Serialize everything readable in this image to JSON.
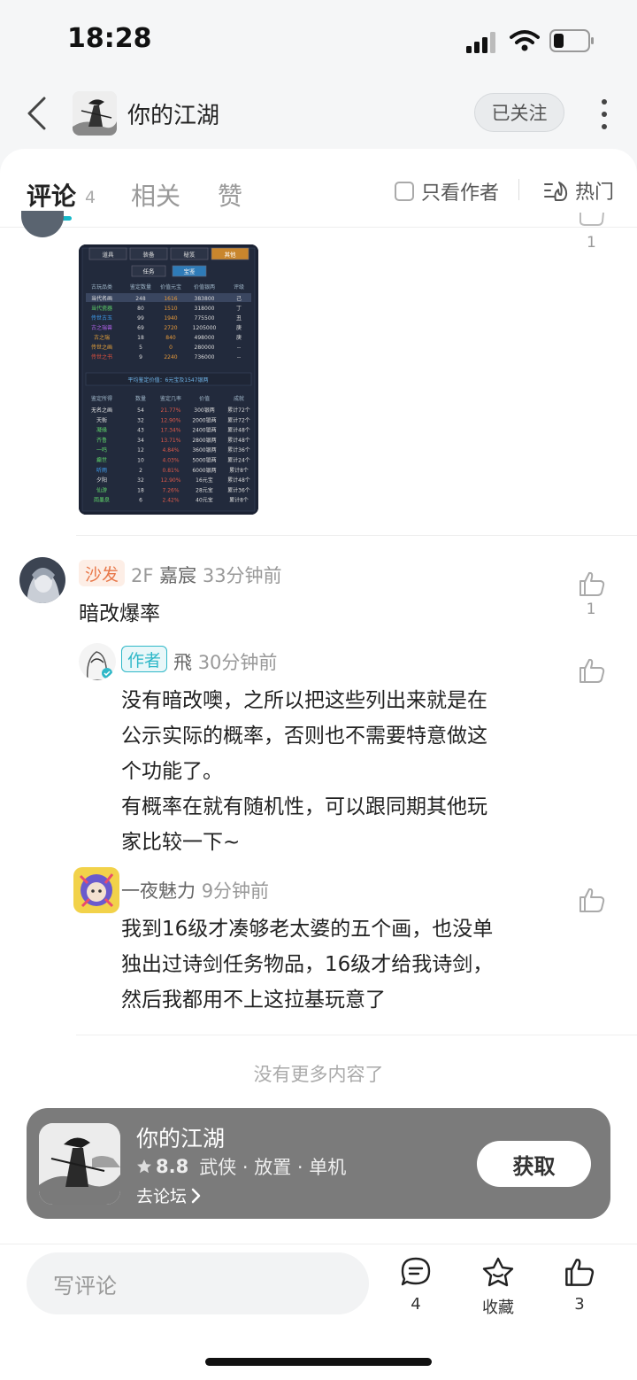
{
  "status": {
    "time": "18:28"
  },
  "header": {
    "title": "你的江湖",
    "follow_label": "已关注"
  },
  "tabs": {
    "comments": "评论",
    "comments_count": "4",
    "related": "相关",
    "likes": "赞",
    "author_only": "只看作者",
    "hot": "热门"
  },
  "partial_like_count": "1",
  "shot": {
    "tabs": [
      "道具",
      "装备",
      "秘笈",
      "其他"
    ],
    "subtabs": [
      "任务",
      "宝鉴"
    ],
    "head1": [
      "古玩品类",
      "鉴定数量",
      "价值元宝",
      "价值银两",
      "评级"
    ],
    "rows1": [
      [
        "当代名画",
        "248",
        "1616",
        "383800",
        "己"
      ],
      [
        "当代瓷器",
        "80",
        "1510",
        "318000",
        "丁"
      ],
      [
        "传世古玉",
        "99",
        "1940",
        "775500",
        "丑"
      ],
      [
        "古之瑞兽",
        "69",
        "2720",
        "1205000",
        "庚"
      ],
      [
        "古之瑞",
        "18",
        "840",
        "498000",
        "庚"
      ],
      [
        "传世之画",
        "5",
        "0",
        "280000",
        "--"
      ],
      [
        "传世之书",
        "9",
        "2240",
        "736000",
        "--"
      ]
    ],
    "avg": "平均鉴定价值：6元宝及1547银两",
    "head2": [
      "鉴定所得",
      "数量",
      "鉴定几率",
      "价值",
      "成就"
    ],
    "rows2": [
      [
        "无名之画",
        "54",
        "21.77%",
        "300银两",
        "累计72个"
      ],
      [
        "天街",
        "32",
        "12.90%",
        "2000银两",
        "累计72个"
      ],
      [
        "凝缘",
        "43",
        "17.34%",
        "2400银两",
        "累计48个"
      ],
      [
        "齐鲁",
        "34",
        "13.71%",
        "2800银两",
        "累计48个"
      ],
      [
        "一鸣",
        "12",
        "4.84%",
        "3600银两",
        "累计36个"
      ],
      [
        "癫世",
        "10",
        "4.03%",
        "5000银两",
        "累计24个"
      ],
      [
        "听雨",
        "2",
        "0.81%",
        "6000银两",
        "累计8个"
      ],
      [
        "夕阳",
        "32",
        "12.90%",
        "16元宝",
        "累计48个"
      ],
      [
        "仙游",
        "18",
        "7.26%",
        "28元宝",
        "累计36个"
      ],
      [
        "雨墨泉",
        "6",
        "2.42%",
        "40元宝",
        "累计8个"
      ]
    ]
  },
  "comments": [
    {
      "badge": "沙发",
      "floor": "2F",
      "author": "嘉宸",
      "time": "33分钟前",
      "text": "暗改爆率",
      "likes": "1"
    },
    {
      "badge": "作者",
      "author": "飛",
      "time": "30分钟前",
      "lines": [
        "没有暗改噢，之所以把这些列出来就是在",
        "公示实际的概率，否则也不需要特意做这",
        "个功能了。",
        "有概率在就有随机性，可以跟同期其他玩",
        "家比较一下~"
      ]
    },
    {
      "author": "一夜魅力",
      "time": "9分钟前",
      "lines": [
        "我到16级才凑够老太婆的五个画，也没单",
        "独出过诗剑任务物品，16级才给我诗剑，",
        "然后我都用不上这拉基玩意了"
      ]
    }
  ],
  "no_more": "没有更多内容了",
  "promo": {
    "name": "你的江湖",
    "score": "8.8",
    "tags": "武侠 · 放置 · 单机",
    "forum": "去论坛",
    "get_label": "获取"
  },
  "bottom": {
    "write_placeholder": "写评论",
    "comment_count": "4",
    "collect_label": "收藏",
    "like_count": "3"
  }
}
